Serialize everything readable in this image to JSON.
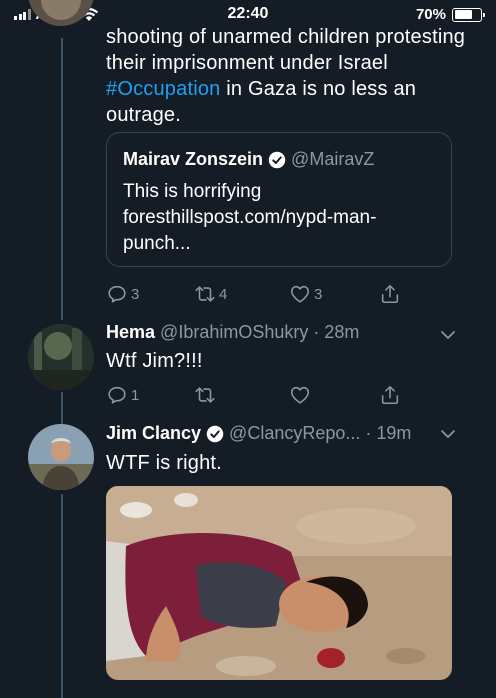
{
  "status_bar": {
    "carrier": "AT&T",
    "time": "22:40",
    "battery": "70%",
    "battery_level": 0.7
  },
  "tweet_top": {
    "text_part1": "shooting of unarmed children protesting their imprisonment under Israel ",
    "hashtag": "#Occupation",
    "text_part2": " in Gaza is no less an outrage.",
    "quote": {
      "name": "Mairav Zonszein",
      "handle": "@MairavZ",
      "body": "This is horrifying foresthillspost.com/nypd-man-punch..."
    },
    "actions": {
      "replies": "3",
      "retweets": "4",
      "likes": "3"
    }
  },
  "tweet_hema": {
    "name": "Hema",
    "handle": "@IbrahimOShukry",
    "time": "· 28m",
    "text": "Wtf Jim?!!!",
    "actions": {
      "replies": "1",
      "retweets": "",
      "likes": ""
    }
  },
  "tweet_jim": {
    "name": "Jim Clancy",
    "handle": "@ClancyRepo...",
    "time": "· 19m",
    "text": "WTF is right."
  },
  "colors": {
    "background": "#141d26",
    "accent": "#1da1f2",
    "muted": "#8899a6",
    "border": "#38444d"
  }
}
